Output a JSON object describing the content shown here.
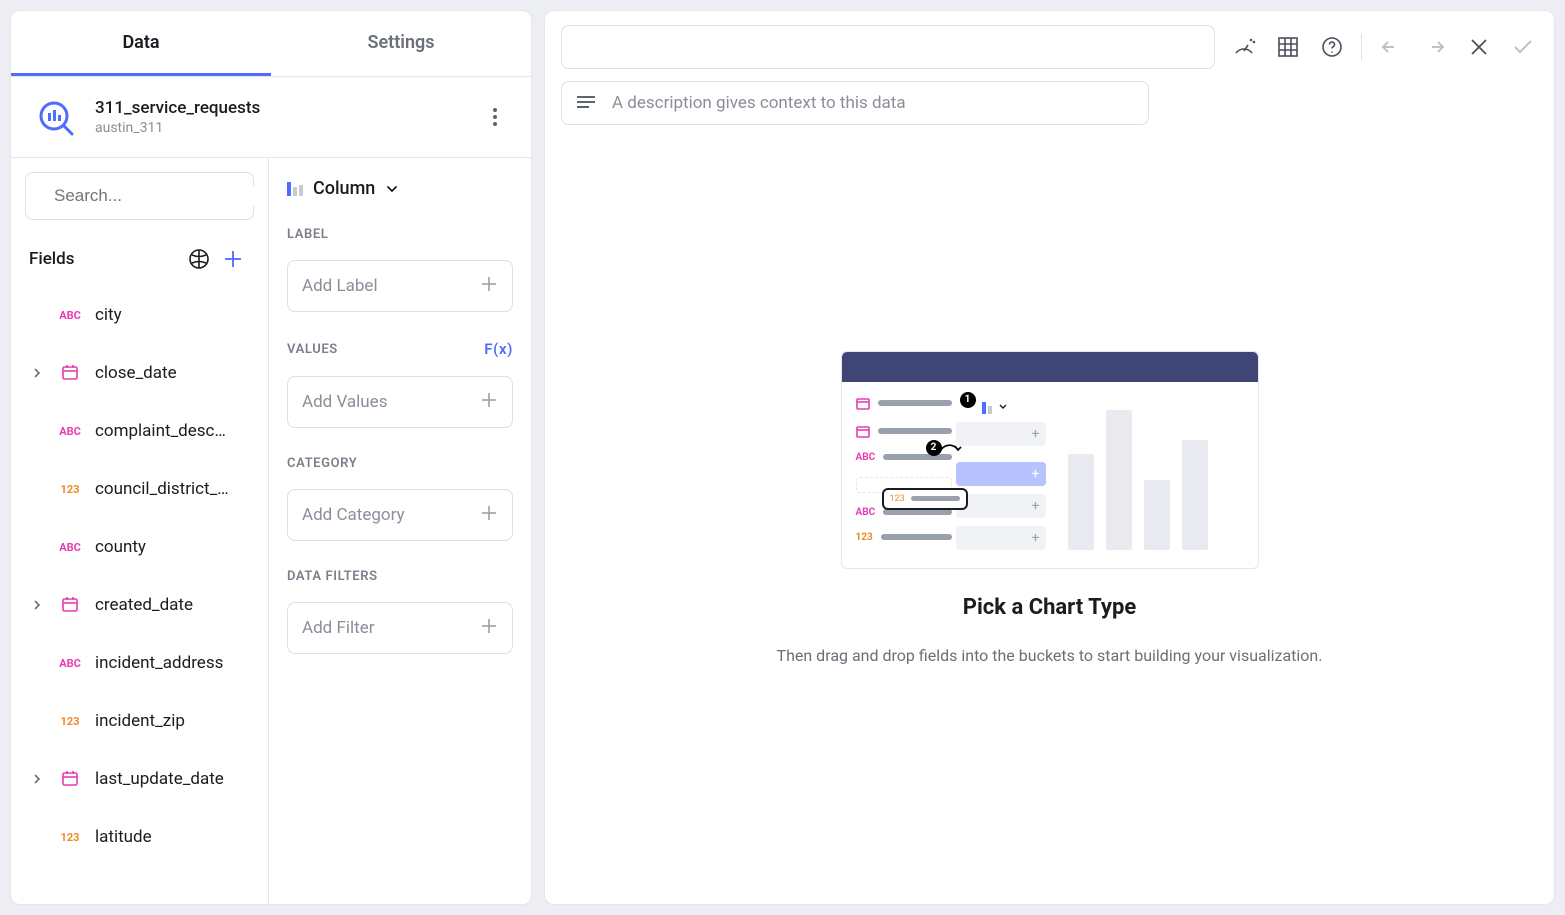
{
  "tabs": {
    "data": "Data",
    "settings": "Settings"
  },
  "datasource": {
    "title": "311_service_requests",
    "subtitle": "austin_311"
  },
  "search": {
    "placeholder": "Search..."
  },
  "fields_header": "Fields",
  "fields": [
    {
      "type": "abc",
      "name": "city",
      "expandable": false
    },
    {
      "type": "date",
      "name": "close_date",
      "expandable": true
    },
    {
      "type": "abc",
      "name": "complaint_desc…",
      "expandable": false
    },
    {
      "type": "123",
      "name": "council_district_…",
      "expandable": false
    },
    {
      "type": "abc",
      "name": "county",
      "expandable": false
    },
    {
      "type": "date",
      "name": "created_date",
      "expandable": true
    },
    {
      "type": "abc",
      "name": "incident_address",
      "expandable": false
    },
    {
      "type": "123",
      "name": "incident_zip",
      "expandable": false
    },
    {
      "type": "date",
      "name": "last_update_date",
      "expandable": true
    },
    {
      "type": "123",
      "name": "latitude",
      "expandable": false
    }
  ],
  "chart_type": "Column",
  "sections": {
    "label": {
      "header": "LABEL",
      "placeholder": "Add Label"
    },
    "values": {
      "header": "VALUES",
      "placeholder": "Add Values",
      "fx": "F(x)"
    },
    "category": {
      "header": "CATEGORY",
      "placeholder": "Add Category"
    },
    "filters": {
      "header": "DATA FILTERS",
      "placeholder": "Add Filter"
    }
  },
  "description_placeholder": "A description gives context to this data",
  "empty_state": {
    "title": "Pick a Chart Type",
    "subtitle": "Then drag and drop fields into the buckets to start building your visualization."
  },
  "type_labels": {
    "abc": "ABC",
    "123": "123"
  }
}
